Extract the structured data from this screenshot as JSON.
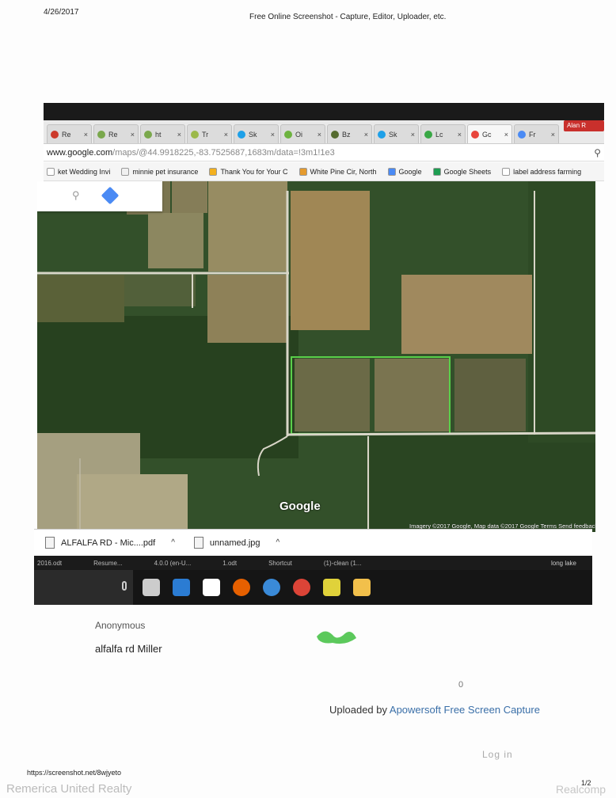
{
  "print_header": {
    "date": "4/26/2017",
    "title": "Free Online Screenshot - Capture, Editor, Uploader, etc."
  },
  "browser": {
    "tabs": [
      {
        "label": "Re",
        "icon": "cs-icon",
        "color": "#cc3a2b"
      },
      {
        "label": "Re",
        "icon": "back-icon",
        "color": "#7aa84c"
      },
      {
        "label": "ht",
        "icon": "leaf-icon",
        "color": "#7aa84c"
      },
      {
        "label": "Tr",
        "icon": "leaf-icon",
        "color": "#9cb94a"
      },
      {
        "label": "Sk",
        "icon": "skype-icon",
        "color": "#1ea0e8"
      },
      {
        "label": "Oi",
        "icon": "gear-icon",
        "color": "#6db33f"
      },
      {
        "label": "Bz",
        "icon": "hex-icon",
        "color": "#556b2f"
      },
      {
        "label": "Sk",
        "icon": "skype-icon",
        "color": "#1ea0e8"
      },
      {
        "label": "Lc",
        "icon": "x-icon",
        "color": "#39a845"
      },
      {
        "label": "Gc",
        "icon": "maps-icon",
        "color": "#e8453c",
        "active": true
      },
      {
        "label": "Fr",
        "icon": "image-icon",
        "color": "#4a8af4"
      }
    ],
    "close_glyph": "×",
    "profile": "Alan R",
    "url_main": "www.google.com",
    "url_rest": "/maps/@44.9918225,-83.7525687,1683m/data=!3m1!1e3",
    "bookmarks": [
      {
        "label": "ket Wedding Invi",
        "color": "#ffffff"
      },
      {
        "label": "minnie pet insurance",
        "color": "#f0f0f0"
      },
      {
        "label": "Thank You for Your C",
        "color": "#f3b01e"
      },
      {
        "label": "White Pine Cir, North",
        "color": "#e59b2e"
      },
      {
        "label": "Google",
        "color": "#4a8af4"
      },
      {
        "label": "Google Sheets",
        "color": "#1e9e52"
      },
      {
        "label": "label address farming",
        "color": "#ffffff"
      }
    ]
  },
  "map": {
    "logo": "Google",
    "attribution": "Imagery ©2017 Google, Map data ©2017 Google    Terms    Send feedback"
  },
  "downloads": [
    {
      "name": "ALFALFA RD - Mic....pdf",
      "chevron": "^"
    },
    {
      "name": "unnamed.jpg",
      "chevron": "^"
    }
  ],
  "desktop_strip": {
    "items": [
      "2016.odt",
      "Resume...",
      "4.0.0 (en-U...",
      "1.odt",
      "Shortcut",
      "(1)-clean (1..."
    ],
    "right": "long lake"
  },
  "taskbar": {
    "icons": [
      {
        "name": "task-view-icon",
        "color": "#cccccc"
      },
      {
        "name": "edge-icon",
        "color": "#2b7cd3"
      },
      {
        "name": "store-icon",
        "color": "#ffffff"
      },
      {
        "name": "firefox-icon",
        "color": "#e66000"
      },
      {
        "name": "ie-icon",
        "color": "#3a8ad8"
      },
      {
        "name": "chrome-icon",
        "color": "#db4437"
      },
      {
        "name": "notes-icon",
        "color": "#e0d23a"
      },
      {
        "name": "explorer-icon",
        "color": "#f2c04b"
      }
    ]
  },
  "page": {
    "author": "Anonymous",
    "caption": "alfalfa rd Miller",
    "count": "0",
    "uploaded_prefix": "Uploaded by ",
    "uploaded_link": "Apowersoft Free Screen Capture",
    "login": "Log in",
    "print_url": "https://screenshot.net/8wjyeto",
    "page_num": "1/2",
    "watermark_left": "Remerica United Realty",
    "watermark_right": "Realcomp"
  }
}
